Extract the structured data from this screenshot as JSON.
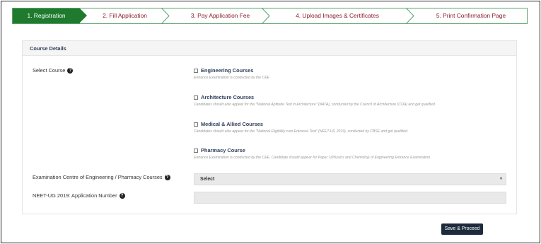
{
  "stepper": {
    "steps": [
      {
        "label": "1. Registration",
        "active": true
      },
      {
        "label": "2. Fill Application",
        "active": false
      },
      {
        "label": "3. Pay Application Fee",
        "active": false
      },
      {
        "label": "4. Upload Images & Certificates",
        "active": false
      },
      {
        "label": "5. Print Confirmation Page",
        "active": false
      }
    ]
  },
  "panel": {
    "title": "Course Details",
    "select_course_label": "Select Course",
    "courses": [
      {
        "title": "Engineering Courses",
        "description": "Entrance Examination is conducted by the CEE"
      },
      {
        "title": "Architecture Courses",
        "description": "Candidates should also appear for the \"National Aptitude Test in Architecture\" (NATA), conducted by the Council of Architecture (COA) and get qualified."
      },
      {
        "title": "Medical & Allied Courses",
        "description": "Candidates should also appear for the \"National Eligibility cum Entrance Test\" (NEET-UG 2019), conducted by CBSE and get qualified."
      },
      {
        "title": "Pharmacy Course",
        "description": "Entrance Examination is conducted by the CEE. Candidate should appear for Paper I (Physics and Chemistry) of Engineering Entrance Examination."
      }
    ],
    "exam_centre_label": "Examination Centre of Engineering / Pharmacy Courses",
    "exam_centre_value": "Select",
    "neet_label": "NEET-UG 2019: Application Number",
    "neet_value": ""
  },
  "actions": {
    "save_label": "Save & Proceed"
  },
  "icons": {
    "help": "question-circle-icon",
    "dropdown": "caret-down-icon",
    "checkbox": "checkbox-icon"
  },
  "colors": {
    "active_step": "#1f7a2e",
    "step_text": "#8a1f2b",
    "button_bg": "#1e2b3c",
    "heading": "#2f3e5a"
  }
}
